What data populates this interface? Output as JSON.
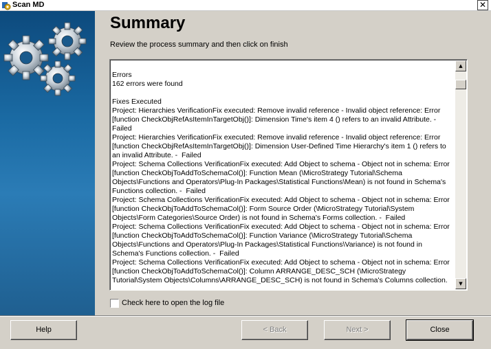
{
  "window": {
    "title": "Scan MD",
    "close_glyph": "✕"
  },
  "page": {
    "title": "Summary",
    "subtitle": "Review the process summary and then click on finish"
  },
  "log": {
    "lines": [
      "Errors",
      "162 errors were found",
      "",
      "Fixes Executed",
      "Project: Hierarchies VerificationFix executed: Remove invalid reference - Invalid object reference: Error [function CheckObjRefAsItemInTargetObj()]: Dimension Time's item 4 () refers to an invalid Attribute. - Failed",
      "Project: Hierarchies VerificationFix executed: Remove invalid reference - Invalid object reference: Error [function CheckObjRefAsItemInTargetObj()]: Dimension User-Defined Time Hierarchy's item 1 () refers to an invalid Attribute. -  Failed",
      "Project: Schema Collections VerificationFix executed: Add Object to schema - Object not in schema: Error [function CheckObjToAddToSchemaCol()]: Function Mean (\\MicroStrategy Tutorial\\Schema Objects\\Functions and Operators\\Plug-In Packages\\Statistical Functions\\Mean) is not found in Schema's Functions collection. -  Failed",
      "Project: Schema Collections VerificationFix executed: Add Object to schema - Object not in schema: Error [function CheckObjToAddToSchemaCol()]: Form Source Order (\\MicroStrategy Tutorial\\System Objects\\Form Categories\\Source Order) is not found in Schema's Forms collection. -  Failed",
      "Project: Schema Collections VerificationFix executed: Add Object to schema - Object not in schema: Error [function CheckObjToAddToSchemaCol()]: Function Variance (\\MicroStrategy Tutorial\\Schema Objects\\Functions and Operators\\Plug-In Packages\\Statistical Functions\\Variance) is not found in Schema's Functions collection. -  Failed",
      "Project: Schema Collections VerificationFix executed: Add Object to schema - Object not in schema: Error [function CheckObjToAddToSchemaCol()]: Column ARRANGE_DESC_SCH (\\MicroStrategy Tutorial\\System Objects\\Columns\\ARRANGE_DESC_SCH) is not found in Schema's Columns collection."
    ]
  },
  "checkbox": {
    "label": "Check here to open the log file",
    "checked": false
  },
  "buttons": {
    "help": "Help",
    "back": "< Back",
    "next": "Next >",
    "close": "Close"
  },
  "icons": {
    "side_art": "gears-icon",
    "app": "app-icon"
  }
}
